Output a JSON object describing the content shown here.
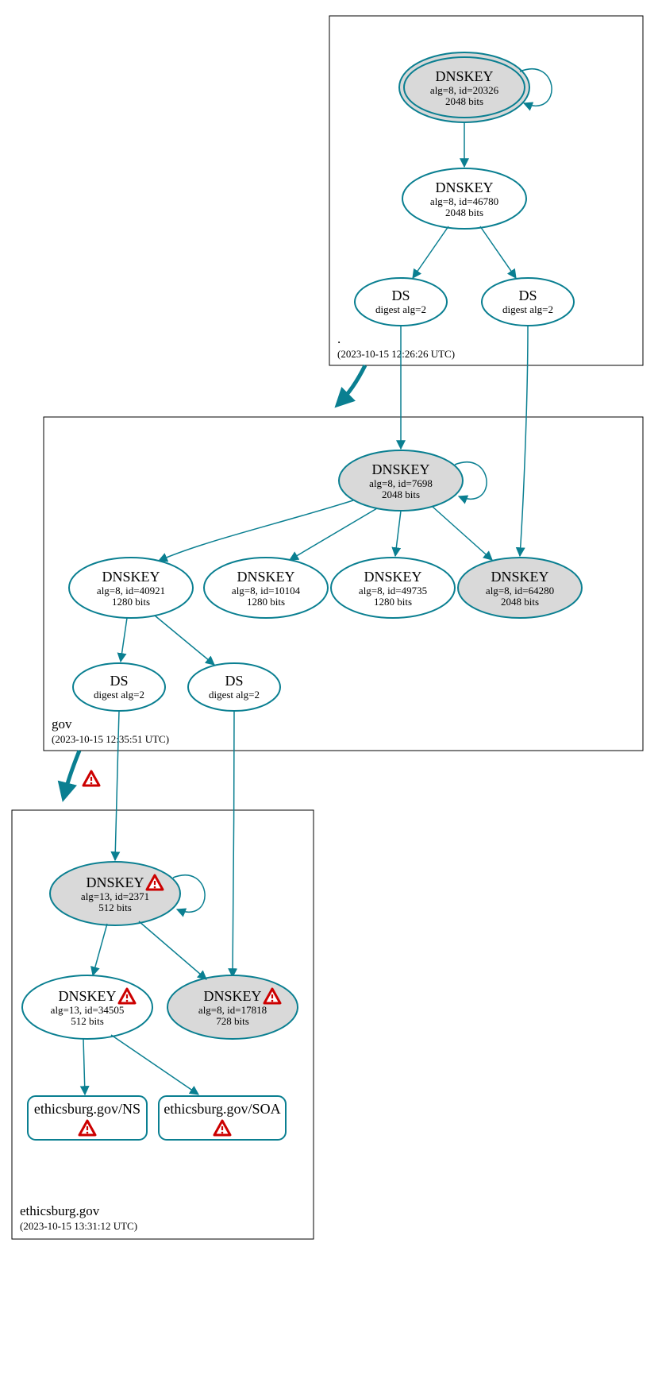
{
  "colors": {
    "stroke": "#0a7f91",
    "fillGray": "#d9d9d9",
    "fillWhite": "#ffffff",
    "warnFill": "#ffffff",
    "warnStroke": "#cc0000"
  },
  "zones": {
    "root": {
      "name": ".",
      "time": "(2023-10-15 12:26:26 UTC)"
    },
    "gov": {
      "name": "gov",
      "time": "(2023-10-15 12:35:51 UTC)"
    },
    "leaf": {
      "name": "ethicsburg.gov",
      "time": "(2023-10-15 13:31:12 UTC)"
    }
  },
  "nodes": {
    "rootKsk": {
      "title": "DNSKEY",
      "l1": "alg=8, id=20326",
      "l2": "2048 bits"
    },
    "rootZsk": {
      "title": "DNSKEY",
      "l1": "alg=8, id=46780",
      "l2": "2048 bits"
    },
    "rootDs1": {
      "title": "DS",
      "l1": "digest alg=2"
    },
    "rootDs2": {
      "title": "DS",
      "l1": "digest alg=2"
    },
    "govKsk": {
      "title": "DNSKEY",
      "l1": "alg=8, id=7698",
      "l2": "2048 bits"
    },
    "govK1": {
      "title": "DNSKEY",
      "l1": "alg=8, id=40921",
      "l2": "1280 bits"
    },
    "govK2": {
      "title": "DNSKEY",
      "l1": "alg=8, id=10104",
      "l2": "1280 bits"
    },
    "govK3": {
      "title": "DNSKEY",
      "l1": "alg=8, id=49735",
      "l2": "1280 bits"
    },
    "govK4": {
      "title": "DNSKEY",
      "l1": "alg=8, id=64280",
      "l2": "2048 bits"
    },
    "govDs1": {
      "title": "DS",
      "l1": "digest alg=2"
    },
    "govDs2": {
      "title": "DS",
      "l1": "digest alg=2"
    },
    "leafKsk": {
      "title": "DNSKEY",
      "l1": "alg=13, id=2371",
      "l2": "512 bits"
    },
    "leafZsk": {
      "title": "DNSKEY",
      "l1": "alg=13, id=34505",
      "l2": "512 bits"
    },
    "leafK2": {
      "title": "DNSKEY",
      "l1": "alg=8, id=17818",
      "l2": "728 bits"
    },
    "leafNs": {
      "title": "ethicsburg.gov/NS"
    },
    "leafSoa": {
      "title": "ethicsburg.gov/SOA"
    }
  }
}
